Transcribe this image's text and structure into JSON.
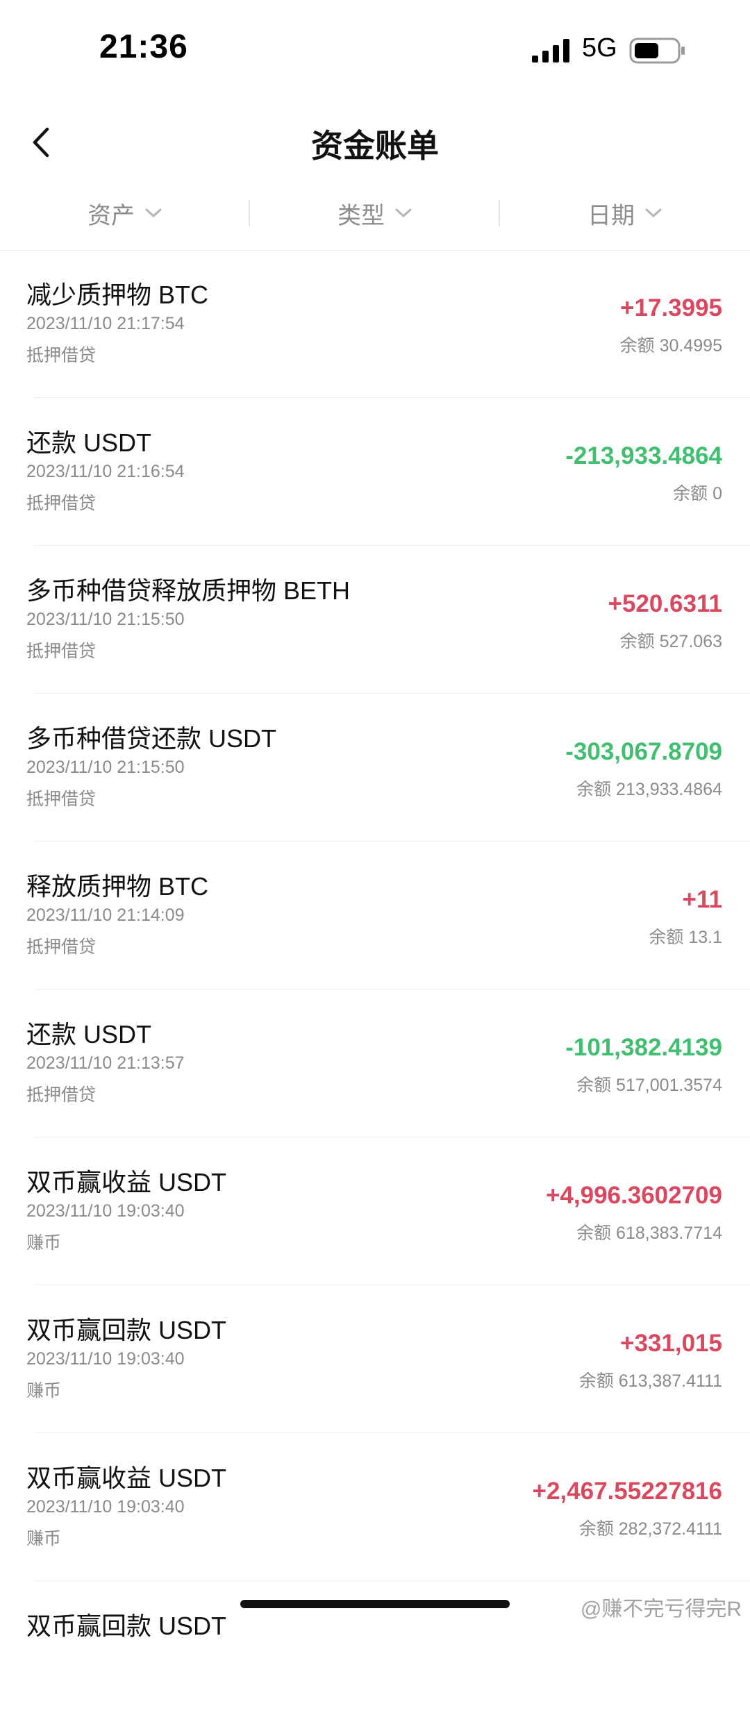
{
  "status_bar": {
    "time": "21:36",
    "network": "5G",
    "icons": [
      "signal-icon",
      "battery-icon"
    ]
  },
  "header": {
    "title": "资金账单",
    "back_icon": "chevron-left-icon"
  },
  "filters": [
    {
      "label": "资产",
      "icon": "chevron-down-icon"
    },
    {
      "label": "类型",
      "icon": "chevron-down-icon"
    },
    {
      "label": "日期",
      "icon": "chevron-down-icon"
    }
  ],
  "colors": {
    "positive": "#d9485f",
    "negative": "#3fbf6f",
    "muted": "#8a8a8a"
  },
  "transactions": [
    {
      "title": "减少质押物 BTC",
      "time": "2023/11/10 21:17:54",
      "category": "抵押借贷",
      "amount": "+17.3995",
      "direction": "positive",
      "balance": "余额 30.4995"
    },
    {
      "title": "还款 USDT",
      "time": "2023/11/10 21:16:54",
      "category": "抵押借贷",
      "amount": "-213,933.4864",
      "direction": "negative",
      "balance": "余额 0"
    },
    {
      "title": "多币种借贷释放质押物 BETH",
      "time": "2023/11/10 21:15:50",
      "category": "抵押借贷",
      "amount": "+520.6311",
      "direction": "positive",
      "balance": "余额 527.063"
    },
    {
      "title": "多币种借贷还款 USDT",
      "time": "2023/11/10 21:15:50",
      "category": "抵押借贷",
      "amount": "-303,067.8709",
      "direction": "negative",
      "balance": "余额 213,933.4864"
    },
    {
      "title": "释放质押物 BTC",
      "time": "2023/11/10 21:14:09",
      "category": "抵押借贷",
      "amount": "+11",
      "direction": "positive",
      "balance": "余额 13.1"
    },
    {
      "title": "还款 USDT",
      "time": "2023/11/10 21:13:57",
      "category": "抵押借贷",
      "amount": "-101,382.4139",
      "direction": "negative",
      "balance": "余额 517,001.3574"
    },
    {
      "title": "双币赢收益 USDT",
      "time": "2023/11/10 19:03:40",
      "category": "赚币",
      "amount": "+4,996.3602709",
      "direction": "positive",
      "balance": "余额 618,383.7714"
    },
    {
      "title": "双币赢回款 USDT",
      "time": "2023/11/10 19:03:40",
      "category": "赚币",
      "amount": "+331,015",
      "direction": "positive",
      "balance": "余额 613,387.4111"
    },
    {
      "title": "双币赢收益 USDT",
      "time": "2023/11/10 19:03:40",
      "category": "赚币",
      "amount": "+2,467.55227816",
      "direction": "positive",
      "balance": "余额 282,372.4111"
    },
    {
      "title": "双币赢回款 USDT",
      "time": "",
      "category": "",
      "amount": "",
      "direction": "positive",
      "balance": ""
    }
  ],
  "watermark": "@赚不完亏得完R"
}
